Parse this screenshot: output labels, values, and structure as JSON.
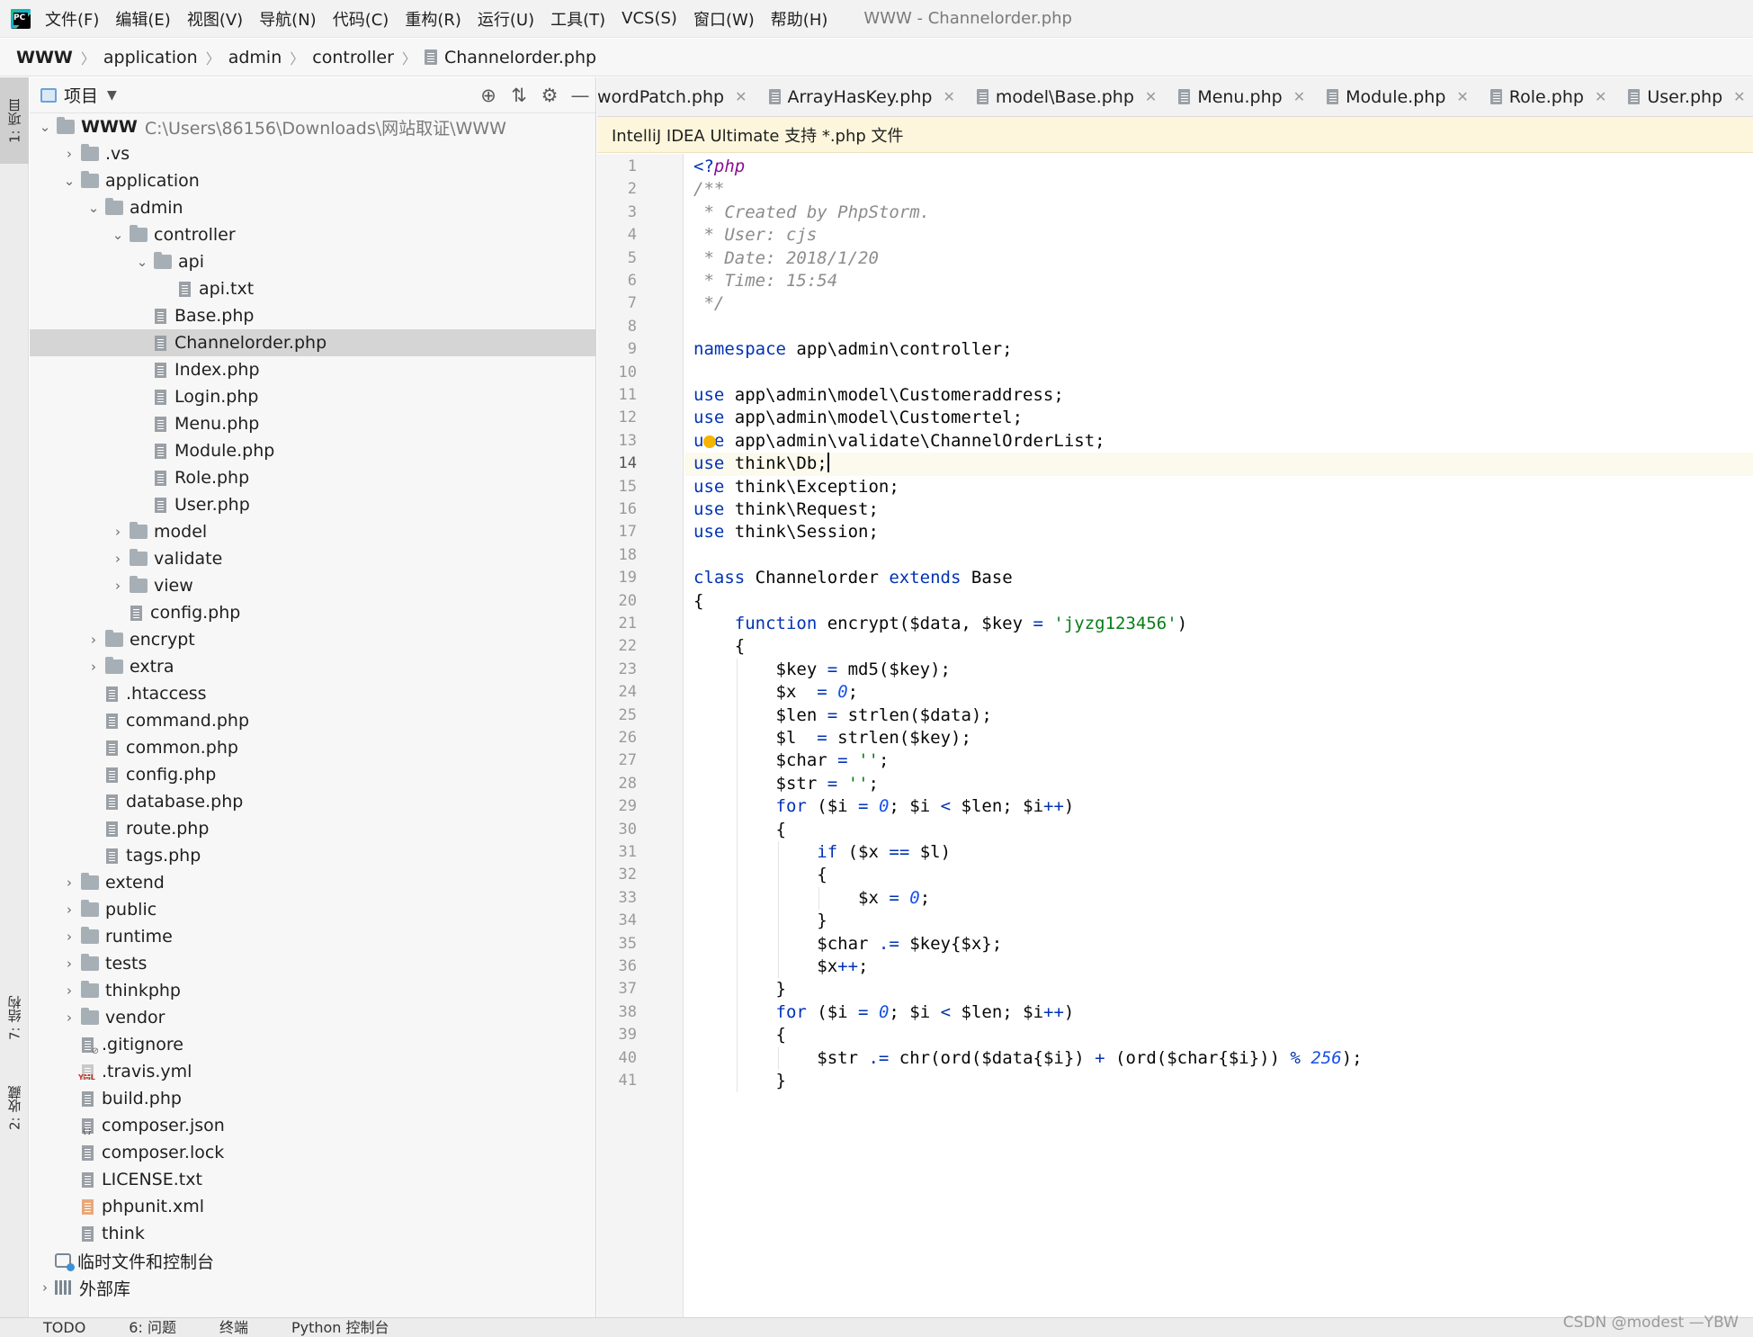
{
  "menubar": {
    "items": [
      "文件(F)",
      "编辑(E)",
      "视图(V)",
      "导航(N)",
      "代码(C)",
      "重构(R)",
      "运行(U)",
      "工具(T)",
      "VCS(S)",
      "窗口(W)",
      "帮助(H)"
    ],
    "window_title": "WWW - Channelorder.php"
  },
  "breadcrumb": [
    "WWW",
    "application",
    "admin",
    "controller",
    "Channelorder.php"
  ],
  "left_strip": {
    "project_tab": "1: 项目",
    "structure_tab": "7: 结构",
    "favorites_tab": "2: 收藏"
  },
  "project_panel": {
    "title": "项目",
    "root_name": "WWW",
    "root_path": "C:\\Users\\86156\\Downloads\\网站取证\\WWW",
    "tree": [
      {
        "label": ".vs",
        "kind": "folder",
        "depth": 1,
        "expand": "closed"
      },
      {
        "label": "application",
        "kind": "folder",
        "depth": 1,
        "expand": "open"
      },
      {
        "label": "admin",
        "kind": "folder",
        "depth": 2,
        "expand": "open"
      },
      {
        "label": "controller",
        "kind": "folder",
        "depth": 3,
        "expand": "open"
      },
      {
        "label": "api",
        "kind": "folder",
        "depth": 4,
        "expand": "open"
      },
      {
        "label": "api.txt",
        "kind": "file",
        "depth": 5,
        "expand": ""
      },
      {
        "label": "Base.php",
        "kind": "file",
        "depth": 4,
        "expand": ""
      },
      {
        "label": "Channelorder.php",
        "kind": "file",
        "depth": 4,
        "expand": "",
        "selected": true
      },
      {
        "label": "Index.php",
        "kind": "file",
        "depth": 4,
        "expand": ""
      },
      {
        "label": "Login.php",
        "kind": "file",
        "depth": 4,
        "expand": ""
      },
      {
        "label": "Menu.php",
        "kind": "file",
        "depth": 4,
        "expand": ""
      },
      {
        "label": "Module.php",
        "kind": "file",
        "depth": 4,
        "expand": ""
      },
      {
        "label": "Role.php",
        "kind": "file",
        "depth": 4,
        "expand": ""
      },
      {
        "label": "User.php",
        "kind": "file",
        "depth": 4,
        "expand": ""
      },
      {
        "label": "model",
        "kind": "folder",
        "depth": 3,
        "expand": "closed"
      },
      {
        "label": "validate",
        "kind": "folder",
        "depth": 3,
        "expand": "closed"
      },
      {
        "label": "view",
        "kind": "folder",
        "depth": 3,
        "expand": "closed"
      },
      {
        "label": "config.php",
        "kind": "file",
        "depth": 3,
        "expand": ""
      },
      {
        "label": "encrypt",
        "kind": "folder",
        "depth": 2,
        "expand": "closed"
      },
      {
        "label": "extra",
        "kind": "folder",
        "depth": 2,
        "expand": "closed"
      },
      {
        "label": ".htaccess",
        "kind": "file",
        "depth": 2,
        "expand": ""
      },
      {
        "label": "command.php",
        "kind": "file",
        "depth": 2,
        "expand": ""
      },
      {
        "label": "common.php",
        "kind": "file",
        "depth": 2,
        "expand": ""
      },
      {
        "label": "config.php",
        "kind": "file",
        "depth": 2,
        "expand": ""
      },
      {
        "label": "database.php",
        "kind": "file",
        "depth": 2,
        "expand": ""
      },
      {
        "label": "route.php",
        "kind": "file",
        "depth": 2,
        "expand": ""
      },
      {
        "label": "tags.php",
        "kind": "file",
        "depth": 2,
        "expand": ""
      },
      {
        "label": "extend",
        "kind": "folder",
        "depth": 1,
        "expand": "closed"
      },
      {
        "label": "public",
        "kind": "folder",
        "depth": 1,
        "expand": "closed"
      },
      {
        "label": "runtime",
        "kind": "folder",
        "depth": 1,
        "expand": "closed"
      },
      {
        "label": "tests",
        "kind": "folder",
        "depth": 1,
        "expand": "closed"
      },
      {
        "label": "thinkphp",
        "kind": "folder",
        "depth": 1,
        "expand": "closed"
      },
      {
        "label": "vendor",
        "kind": "folder",
        "depth": 1,
        "expand": "closed"
      },
      {
        "label": ".gitignore",
        "kind": "git",
        "depth": 1,
        "expand": ""
      },
      {
        "label": ".travis.yml",
        "kind": "yml",
        "depth": 1,
        "expand": ""
      },
      {
        "label": "build.php",
        "kind": "file",
        "depth": 1,
        "expand": ""
      },
      {
        "label": "composer.json",
        "kind": "json",
        "depth": 1,
        "expand": ""
      },
      {
        "label": "composer.lock",
        "kind": "file",
        "depth": 1,
        "expand": ""
      },
      {
        "label": "LICENSE.txt",
        "kind": "file",
        "depth": 1,
        "expand": ""
      },
      {
        "label": "phpunit.xml",
        "kind": "xml",
        "depth": 1,
        "expand": ""
      },
      {
        "label": "think",
        "kind": "file",
        "depth": 1,
        "expand": ""
      },
      {
        "label": "临时文件和控制台",
        "kind": "scratch",
        "depth": 0,
        "expand": ""
      },
      {
        "label": "外部库",
        "kind": "lib",
        "depth": 0,
        "expand": "closed"
      }
    ]
  },
  "editor": {
    "tabs": [
      "wordPatch.php",
      "ArrayHasKey.php",
      "model\\Base.php",
      "Menu.php",
      "Module.php",
      "Role.php",
      "User.php"
    ],
    "notice": "IntelliJ IDEA Ultimate 支持 *.php 文件",
    "current_line": 14,
    "lines": [
      "<?php",
      "/**",
      " * Created by PhpStorm.",
      " * User: cjs",
      " * Date: 2018/1/20",
      " * Time: 15:54",
      " */",
      "",
      "namespace app\\admin\\controller;",
      "",
      "use app\\admin\\model\\Customeraddress;",
      "use app\\admin\\model\\Customertel;",
      "use app\\admin\\validate\\ChannelOrderList;",
      "use think\\Db;",
      "use think\\Exception;",
      "use think\\Request;",
      "use think\\Session;",
      "",
      "class Channelorder extends Base",
      "{",
      "    function encrypt($data, $key = 'jyzg123456')",
      "    {",
      "        $key = md5($key);",
      "        $x  = 0;",
      "        $len = strlen($data);",
      "        $l  = strlen($key);",
      "        $char = '';",
      "        $str = '';",
      "        for ($i = 0; $i < $len; $i++)",
      "        {",
      "            if ($x == $l)",
      "            {",
      "                $x = 0;",
      "            }",
      "            $char .= $key{$x};",
      "            $x++;",
      "        }",
      "        for ($i = 0; $i < $len; $i++)",
      "        {",
      "            $str .= chr(ord($data{$i}) + (ord($char{$i})) % 256);",
      "        }"
    ]
  },
  "bottombar": {
    "items": [
      "TODO",
      "6: 问题",
      "终端",
      "Python 控制台"
    ]
  },
  "watermark": "CSDN @modest —YBW"
}
